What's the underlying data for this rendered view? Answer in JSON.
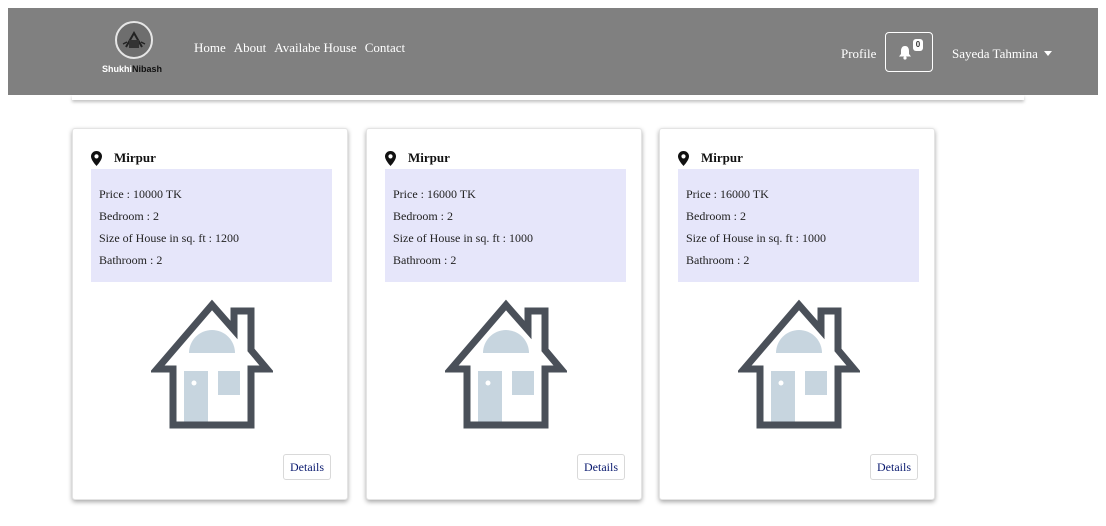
{
  "brand": {
    "logo_text_part1": "Shukhi",
    "logo_text_part2": "Nibash"
  },
  "nav": {
    "links": [
      "Home",
      "About",
      "Availabe House",
      "Contact"
    ]
  },
  "header_right": {
    "profile_label": "Profile",
    "notification_count": "0",
    "user_name": "Sayeda Tahmina"
  },
  "colors": {
    "navbar_bg": "#808080",
    "info_box_bg": "#e6e6fa",
    "house_dark": "#4a5059",
    "house_light": "#c7d5df"
  },
  "cards": [
    {
      "location": "Mirpur",
      "price": "Price : 10000 TK",
      "bedroom": "Bedroom : 2",
      "size": "Size of House in sq. ft : 1200",
      "bathroom": "Bathroom : 2",
      "button_label": "Details"
    },
    {
      "location": "Mirpur",
      "price": "Price : 16000 TK",
      "bedroom": "Bedroom : 2",
      "size": "Size of House in sq. ft : 1000",
      "bathroom": "Bathroom : 2",
      "button_label": "Details"
    },
    {
      "location": "Mirpur",
      "price": "Price : 16000 TK",
      "bedroom": "Bedroom : 2",
      "size": "Size of House in sq. ft : 1000",
      "bathroom": "Bathroom : 2",
      "button_label": "Details"
    }
  ]
}
